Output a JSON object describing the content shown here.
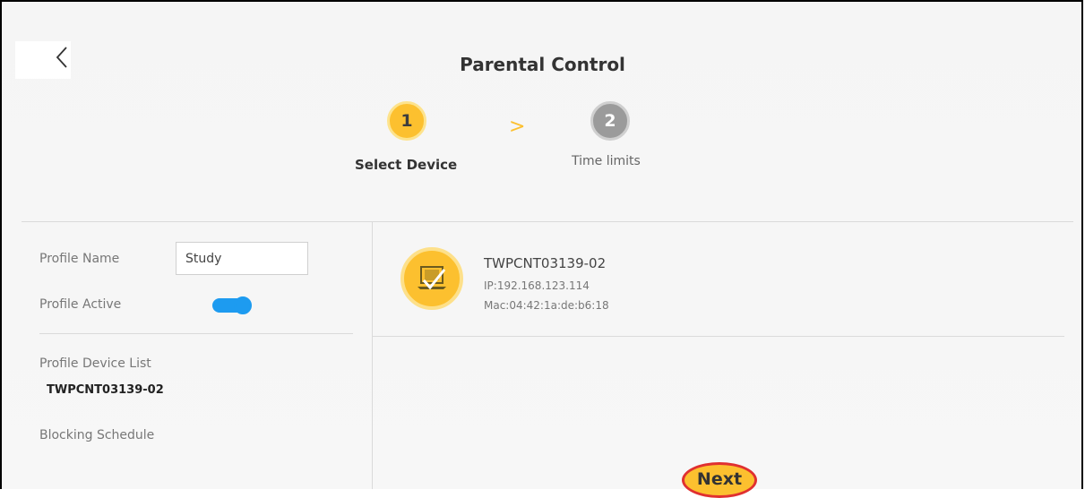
{
  "header": {
    "title": "Parental Control",
    "back_icon": "chevron-left-icon"
  },
  "steps": [
    {
      "number": "1",
      "label": "Select Device",
      "active": true
    },
    {
      "number": "2",
      "label": "Time limits",
      "active": false
    }
  ],
  "step_separator": ">",
  "profile": {
    "name_label": "Profile Name",
    "name_value": "Study",
    "active_label": "Profile Active",
    "active": true,
    "device_list_label": "Profile Device List",
    "device_list_value": "TWPCNT03139-02",
    "blocking_schedule_label": "Blocking Schedule"
  },
  "device": {
    "name": "TWPCNT03139-02",
    "ip": "IP:192.168.123.114",
    "mac": "Mac:04:42:1a:de:b6:18",
    "icon": "laptop-check-icon",
    "selected": true
  },
  "actions": {
    "next_label": "Next"
  },
  "colors": {
    "accent": "#fcc02f",
    "toggle": "#1d9bf0",
    "highlight_ring": "#e03030",
    "step_inactive": "#9b9b9b"
  }
}
